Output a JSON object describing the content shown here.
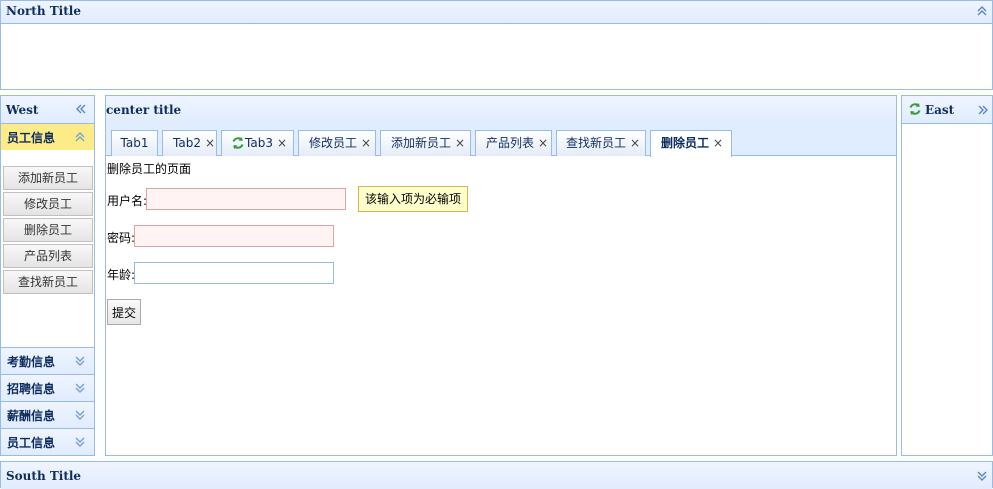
{
  "north": {
    "title": "North Title"
  },
  "west": {
    "title": "West",
    "active_section": "员工信息",
    "items": [
      "添加新员工",
      "修改员工",
      "删除员工",
      "产品列表",
      "查找新员工"
    ],
    "sections": [
      "考勤信息",
      "招聘信息",
      "薪酬信息",
      "员工信息"
    ]
  },
  "center": {
    "title": "center title",
    "tabs": [
      {
        "label": "Tab1"
      },
      {
        "label": "Tab2"
      },
      {
        "label": "Tab3"
      },
      {
        "label": "修改员工"
      },
      {
        "label": "添加新员工"
      },
      {
        "label": "产品列表"
      },
      {
        "label": "查找新员工"
      },
      {
        "label": "删除员工"
      }
    ],
    "close_glyph": "×",
    "page_heading": "删除员工的页面",
    "form": {
      "username_label": "用户名:",
      "password_label": "密码:",
      "age_label": "年龄:",
      "required_tip": "该输入项为必输项",
      "submit_label": "提交"
    }
  },
  "east": {
    "title": "East"
  },
  "south": {
    "title": "South Title"
  },
  "colors": {
    "border": "#99bbe8",
    "header_bg": "#e0ecff",
    "title_text": "#0e2d5f",
    "active_accordion": "#fbec88",
    "tooltip_bg": "#ffffcc",
    "invalid_field_bg": "#fff3f3"
  }
}
